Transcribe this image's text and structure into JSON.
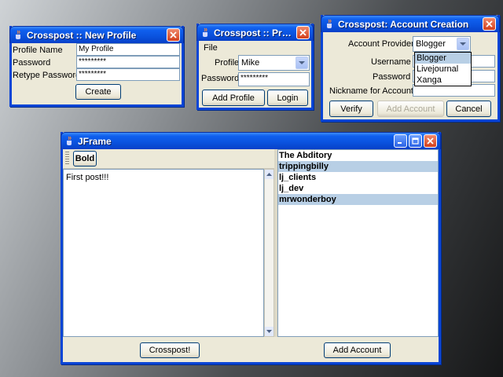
{
  "new_profile": {
    "title": "Crosspost :: New Profile",
    "profile_name_label": "Profile Name",
    "profile_name_value": "My Profile",
    "password_label": "Password",
    "password_value": "*********",
    "retype_label": "Retype Password",
    "retype_value": "*********",
    "create_label": "Create"
  },
  "login": {
    "title": "Crosspost :: Profil...",
    "menu_file": "File",
    "profile_label": "Profile",
    "profile_value": "Mike",
    "password_label": "Password",
    "password_value": "*********",
    "add_profile_label": "Add Profile",
    "login_label": "Login"
  },
  "account_creation": {
    "title": "Crosspost: Account Creation",
    "provider_label": "Account Provider",
    "provider_value": "Blogger",
    "provider_options": [
      "Blogger",
      "Livejournal",
      "Xanga"
    ],
    "username_label": "Username",
    "password_label": "Password",
    "nickname_label": "Nickname for Account",
    "verify_label": "Verify",
    "add_account_label": "Add Account",
    "cancel_label": "Cancel"
  },
  "jframe": {
    "title": "JFrame",
    "bold_label": "Bold",
    "editor_text": "First post!!!",
    "accounts": [
      "The Abditory",
      "trippingbilly",
      "lj_clients",
      "lj_dev",
      "mrwonderboy"
    ],
    "crosspost_label": "Crosspost!",
    "add_account_label": "Add Account"
  },
  "colors": {
    "titlebar": "#0a52de",
    "selection": "#b8cfe5",
    "window_bg": "#ece9d8"
  }
}
